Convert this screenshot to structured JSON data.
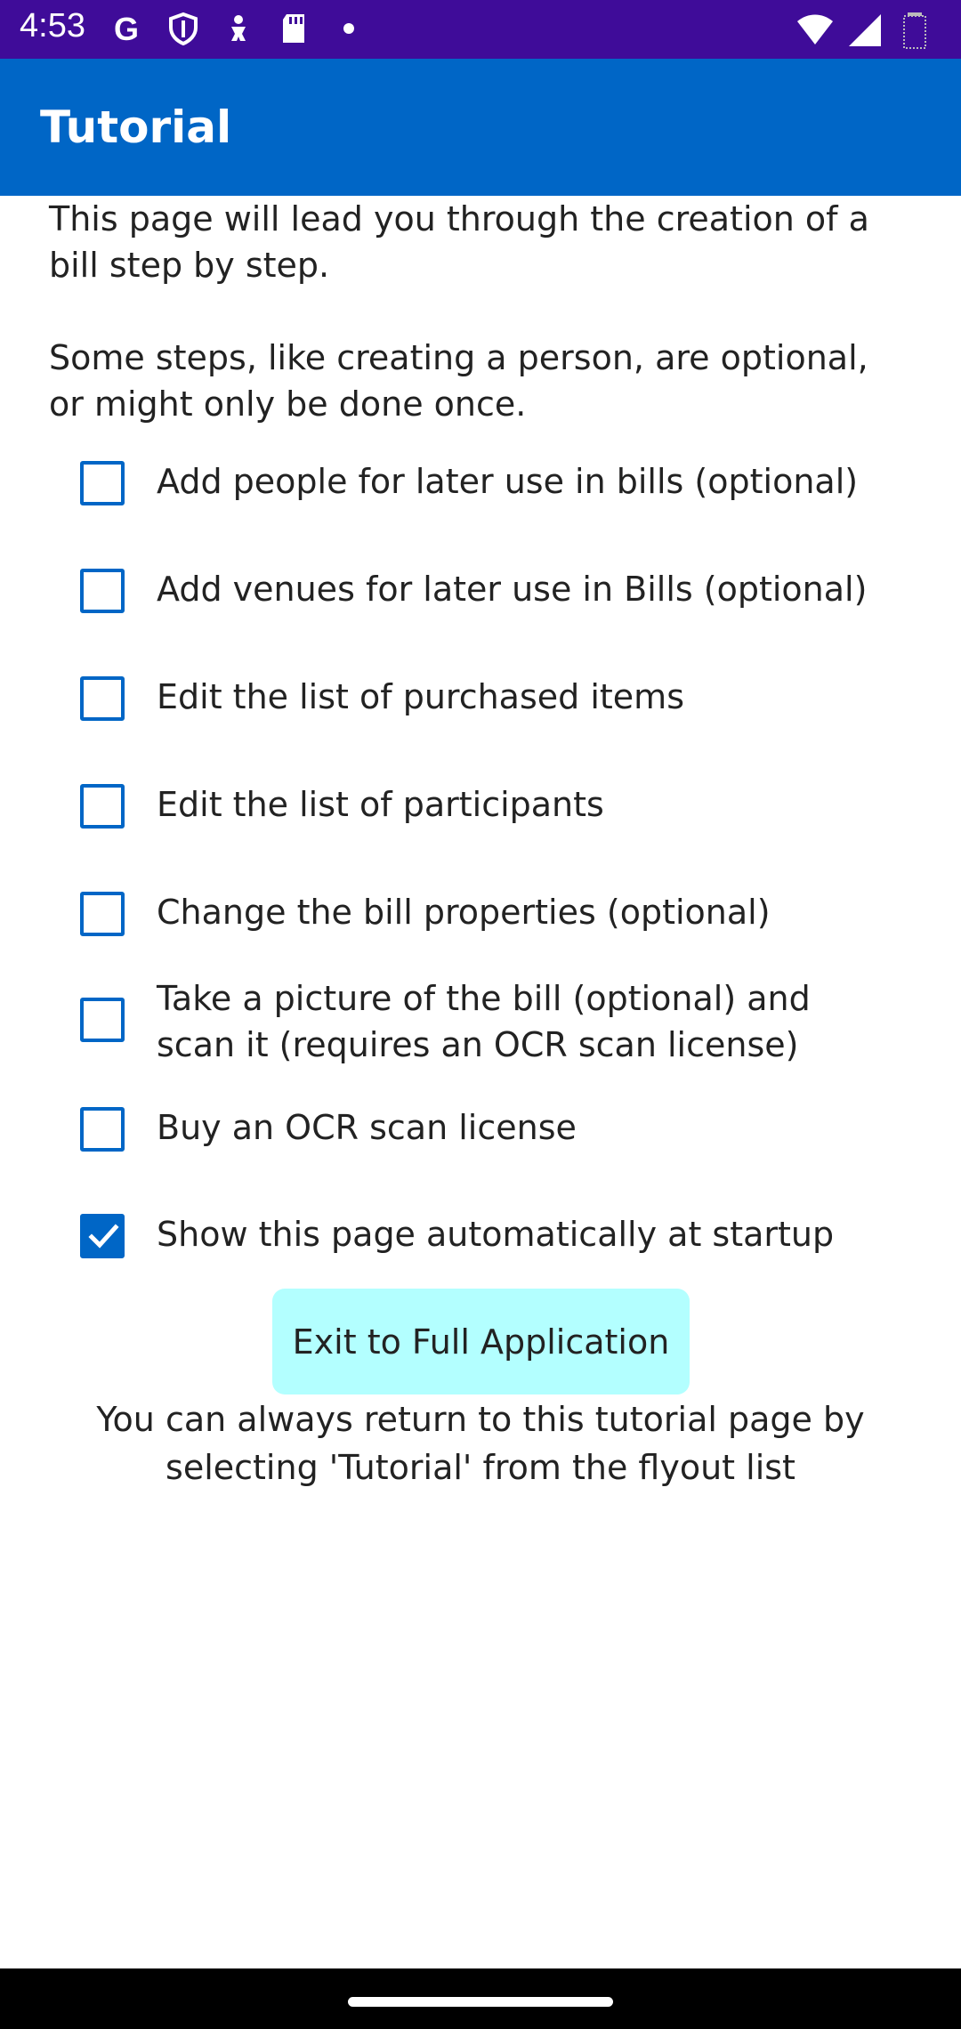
{
  "status_bar": {
    "time": "4:53",
    "left_icons": [
      "google-icon",
      "shield-icon",
      "dog-icon",
      "sd-card-icon",
      "dot-icon"
    ],
    "right_icons": [
      "wifi-icon",
      "signal-icon",
      "battery-icon"
    ]
  },
  "app_bar": {
    "title": "Tutorial",
    "color": "#0066c6"
  },
  "intro": {
    "paragraph_1": "This page will lead you through the creation of a bill step by step.",
    "paragraph_2": "Some steps, like creating a person, are optional, or might only be done once."
  },
  "steps": [
    {
      "label": "Add people for later use in bills (optional)",
      "checked": false
    },
    {
      "label": "Add venues for later use in Bills (optional)",
      "checked": false
    },
    {
      "label": "Edit the list of purchased items",
      "checked": false
    },
    {
      "label": "Edit the list of participants",
      "checked": false
    },
    {
      "label": "Change the bill properties (optional)",
      "checked": false
    },
    {
      "label": "Take a picture of the bill (optional) and scan it (requires an OCR scan license)",
      "checked": false
    },
    {
      "label": "Buy an OCR scan license",
      "checked": false
    },
    {
      "label": "Show this page automatically at startup",
      "checked": true
    }
  ],
  "exit_button": {
    "label": "Exit to Full Application",
    "color": "#b3ffff"
  },
  "footer_note": "You can always return to this tutorial page by selecting 'Tutorial' from the flyout list"
}
